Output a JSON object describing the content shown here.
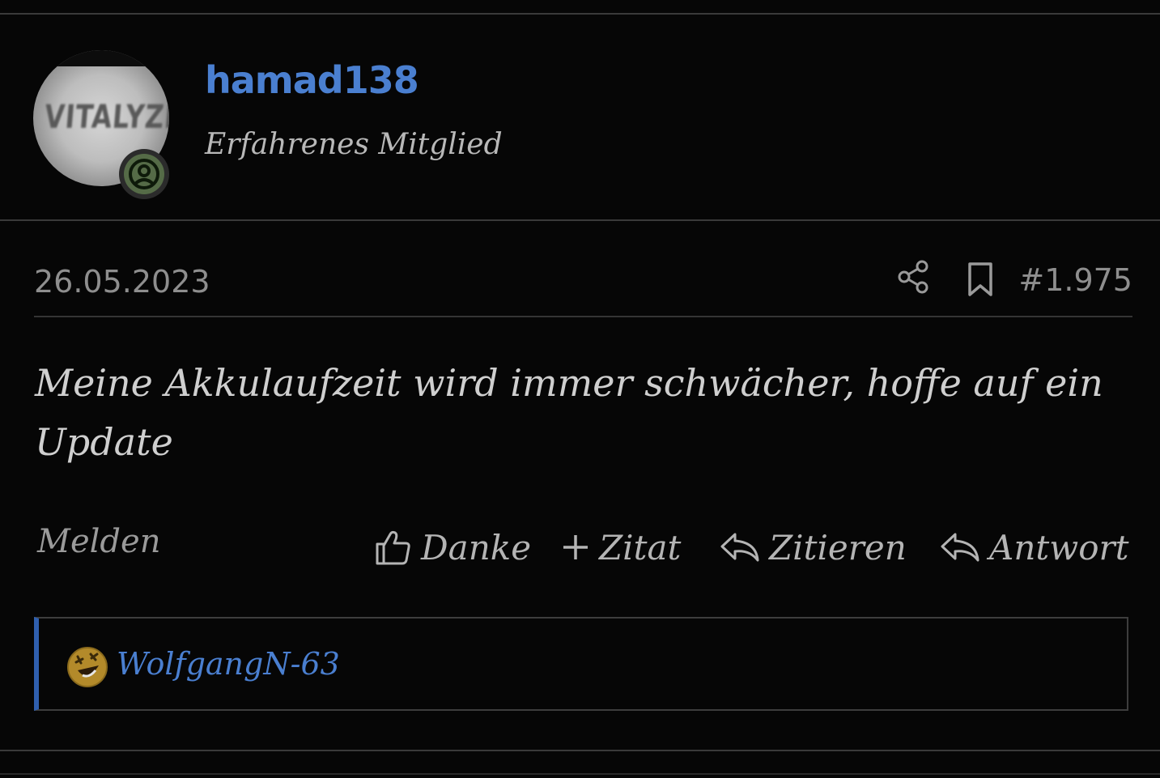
{
  "user": {
    "name": "hamad138",
    "title": "Erfahrenes Mitglied",
    "avatar_text": "VITALYZD",
    "avatar_alt": "avatar",
    "status_icon": "user-circle-icon"
  },
  "post": {
    "date": "26.05.2023",
    "number": "#1.975",
    "body": "Meine Akkulaufzeit wird immer schwächer, hoffe auf ein Update"
  },
  "actions": {
    "report": "Melden",
    "thanks": "Danke",
    "multi_quote": "Zitat",
    "quote": "Zitieren",
    "reply": "Antwort"
  },
  "reactions": {
    "emoji": "rolling-on-floor-laughing-icon",
    "user": "WolfgangN-63"
  },
  "colors": {
    "background": "#060606",
    "link": "#4a7fd0",
    "accent_border": "#2f5fae",
    "online_badge": "#556b47"
  }
}
